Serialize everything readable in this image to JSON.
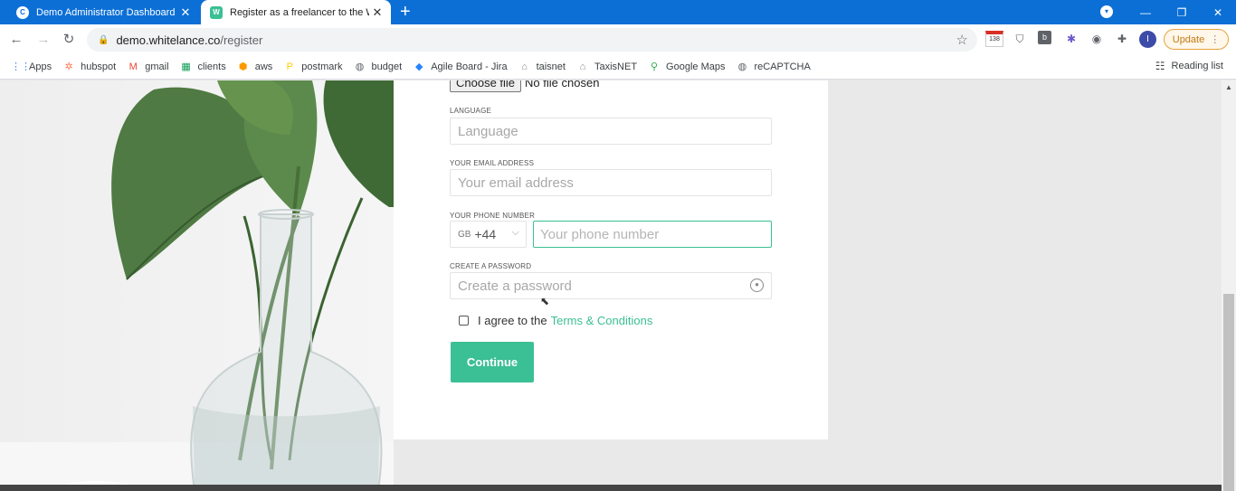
{
  "browser": {
    "tabs": [
      {
        "title": "Demo Administrator Dashboard",
        "favicon": "C",
        "close": "✕"
      },
      {
        "title": "Register as a freelancer to the W",
        "favicon": "W",
        "close": "✕"
      }
    ],
    "new_tab": "+",
    "window_controls": {
      "minimize": "—",
      "maximize": "❐",
      "close": "✕"
    },
    "url_host": "demo.whitelance.co",
    "url_path": "/register",
    "update_label": "Update",
    "avatar_letter": "I",
    "calendar_badge": "138"
  },
  "bookmarks": [
    {
      "label": "Apps",
      "icon": "apps-grid-icon",
      "color": "#4285f4"
    },
    {
      "label": "hubspot",
      "icon": "hubspot-icon",
      "color": "#ff7a59"
    },
    {
      "label": "gmail",
      "icon": "gmail-icon",
      "color": "#ea4335"
    },
    {
      "label": "clients",
      "icon": "sheets-icon",
      "color": "#0f9d58"
    },
    {
      "label": "aws",
      "icon": "aws-icon",
      "color": "#ff9900"
    },
    {
      "label": "postmark",
      "icon": "postmark-icon",
      "color": "#ffcc00"
    },
    {
      "label": "budget",
      "icon": "globe-icon",
      "color": "#5f6368"
    },
    {
      "label": "Agile Board - Jira",
      "icon": "jira-icon",
      "color": "#2684ff"
    },
    {
      "label": "taisnet",
      "icon": "building-icon",
      "color": "#8a8a8a"
    },
    {
      "label": "TaxisNET",
      "icon": "building-icon",
      "color": "#8a8a8a"
    },
    {
      "label": "Google Maps",
      "icon": "maps-pin-icon",
      "color": "#34a853"
    },
    {
      "label": "reCAPTCHA",
      "icon": "globe-icon",
      "color": "#5f6368"
    }
  ],
  "reading_list": "Reading list",
  "form": {
    "file_button": "Choose file",
    "file_status": "No file chosen",
    "language_label": "LANGUAGE",
    "language_placeholder": "Language",
    "email_label": "YOUR EMAIL ADDRESS",
    "email_placeholder": "Your email address",
    "phone_label": "YOUR PHONE NUMBER",
    "phone_country_iso": "GB",
    "phone_country_dial": "+44",
    "phone_placeholder": "Your phone number",
    "password_label": "CREATE A PASSWORD",
    "password_placeholder": "Create a password",
    "agree_text": "I agree to the",
    "terms_link": "Terms & Conditions",
    "continue_label": "Continue"
  },
  "colors": {
    "accent": "#3bbf94",
    "chrome_blue": "#0b6fd6"
  }
}
